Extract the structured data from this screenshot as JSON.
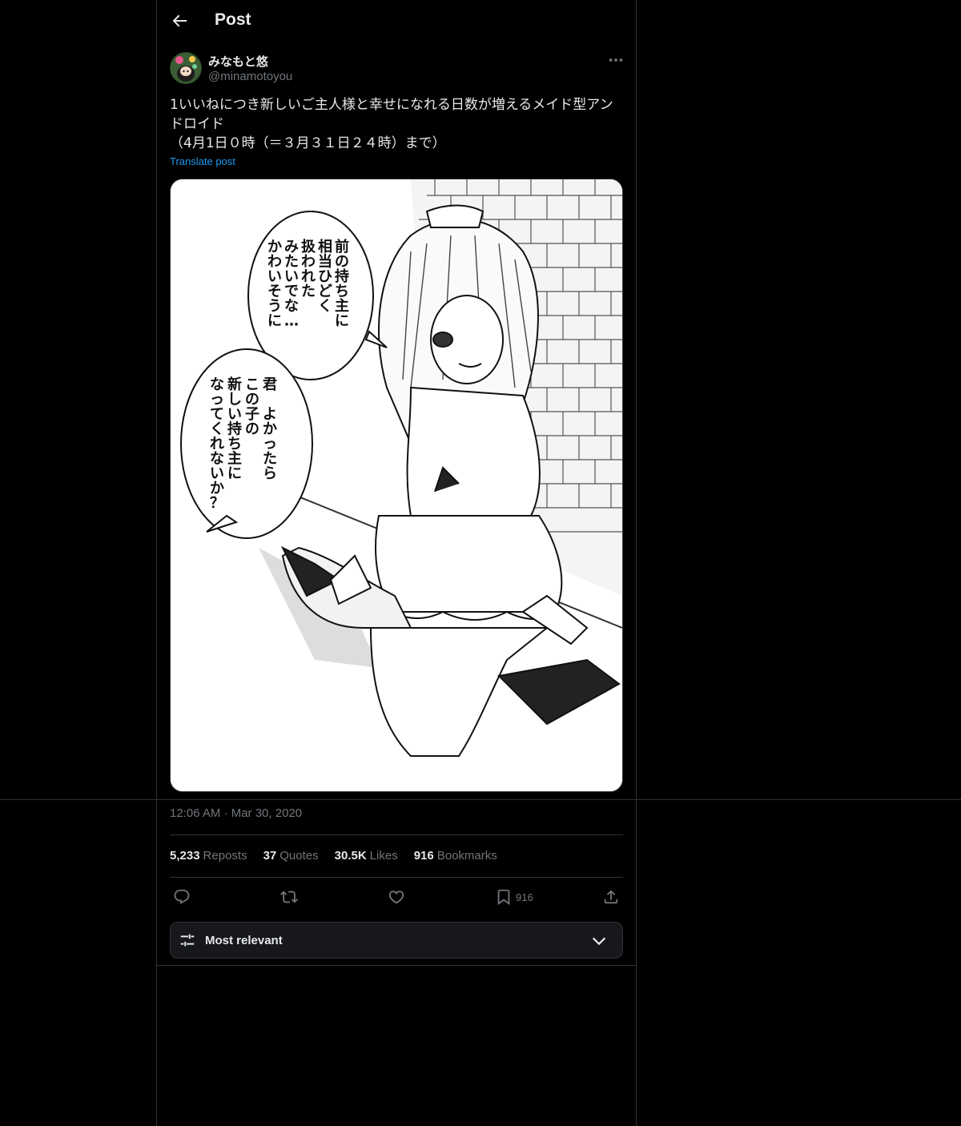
{
  "header": {
    "title": "Post"
  },
  "author": {
    "display_name": "みなもと悠",
    "handle": "@minamotoyou"
  },
  "post": {
    "text": "1いいねにつき新しいご主人様と幸せになれる日数が増えるメイド型アンドロイド\n（4月1日０時（＝３月３１日２４時）まで）",
    "translate_label": "Translate post",
    "timestamp": "12:06 AM · Mar 30, 2020"
  },
  "media": {
    "bubble_top": [
      "前の持ち主に",
      "相当ひどく",
      "扱われた",
      "みたいでな…",
      "かわいそうに"
    ],
    "bubble_bottom": [
      "君　よかったら",
      "この子の",
      "新しい持ち主に",
      "なってくれないか？"
    ]
  },
  "stats": {
    "reposts_count": "5,233",
    "reposts_label": "Reposts",
    "quotes_count": "37",
    "quotes_label": "Quotes",
    "likes_count": "30.5K",
    "likes_label": "Likes",
    "bookmarks_count": "916",
    "bookmarks_label": "Bookmarks"
  },
  "actions": {
    "bookmark_count": "916"
  },
  "replies_sort": {
    "label": "Most relevant"
  },
  "icons": {
    "back": "arrow-left-icon",
    "more": "more-horizontal-icon",
    "reply": "reply-icon",
    "repost": "repost-icon",
    "like": "heart-icon",
    "bookmark": "bookmark-icon",
    "share": "share-icon",
    "sort": "sliders-icon",
    "chevron": "chevron-down-icon"
  },
  "colors": {
    "accent": "#1d9bf0",
    "background": "#000000",
    "border": "#2f3336",
    "muted": "#71767b"
  }
}
